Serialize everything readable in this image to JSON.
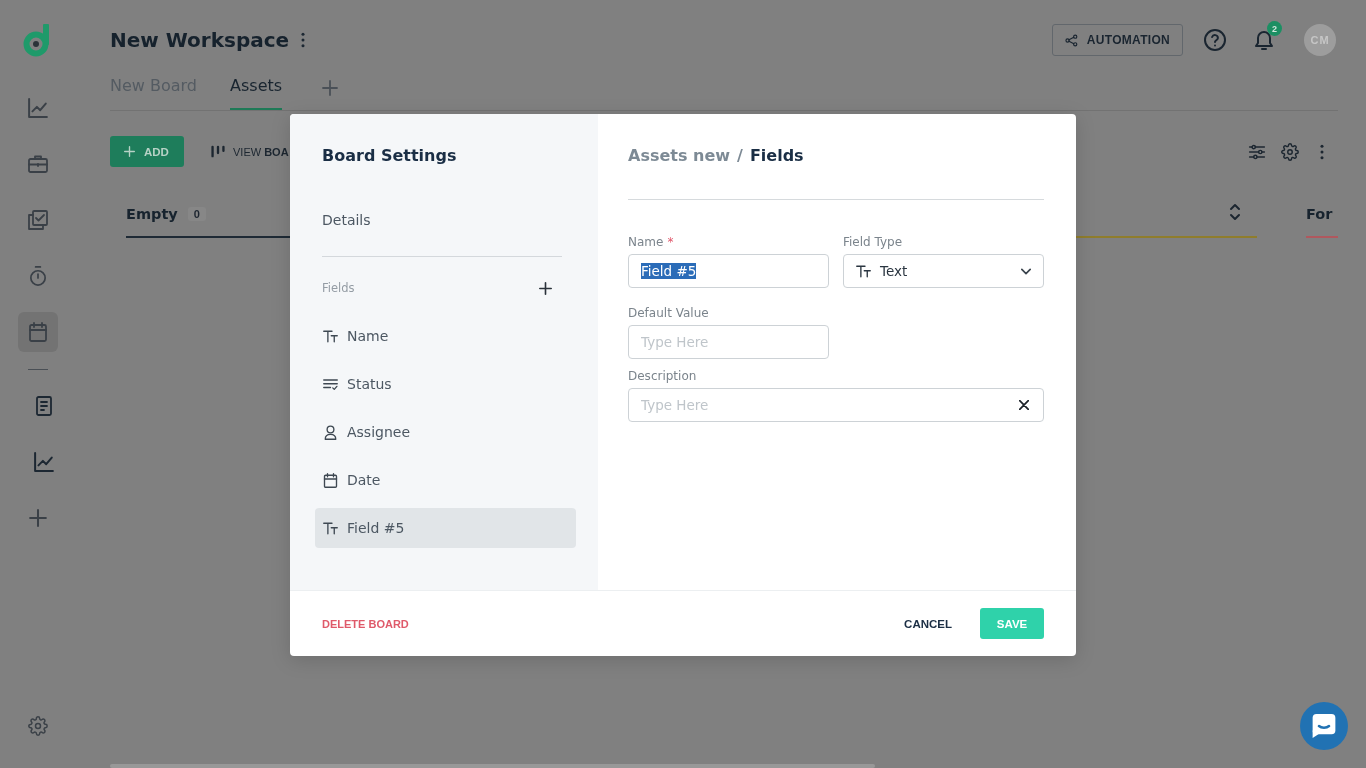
{
  "rail": {
    "items": [
      {
        "selected": false
      },
      {
        "selected": false
      },
      {
        "selected": false
      },
      {
        "selected": false
      },
      {
        "selected": true
      }
    ],
    "more_items": [
      {
        "selected": false
      },
      {
        "selected": false
      }
    ]
  },
  "header": {
    "title": "New Workspace",
    "automation_button": "AUTOMATION",
    "notification_count": "2",
    "avatar_initials": "CM"
  },
  "tabs": [
    {
      "label": "New Board",
      "selected": false
    },
    {
      "label": "Assets",
      "selected": true
    }
  ],
  "toolbar": {
    "add_button": "ADD",
    "view_button": "VIEW **BOA**"
  },
  "board": {
    "columns": [
      {
        "title": "Empty",
        "count": "0",
        "color": "#1e2a35"
      },
      {
        "color": "#8f7d2c"
      },
      {
        "title": "For",
        "color": "#b0585e"
      }
    ]
  },
  "modal": {
    "title": "Board Settings",
    "details": "Details",
    "fields_heading": "Fields",
    "fields": [
      {
        "label": "Name",
        "kind": "text",
        "selected": false
      },
      {
        "label": "Status",
        "kind": "status",
        "selected": false
      },
      {
        "label": "Assignee",
        "kind": "person",
        "selected": false
      },
      {
        "label": "Date",
        "kind": "date",
        "selected": false
      },
      {
        "label": "Field #5",
        "kind": "text",
        "selected": true
      }
    ],
    "breadcrumb": {
      "parent": "Assets new",
      "separator": "/",
      "current": "Fields"
    },
    "form": {
      "name": {
        "label": "Name",
        "required_mark": "*",
        "value": "Field #5",
        "highlighted": true
      },
      "field_type": {
        "label": "Field Type",
        "value": "Text",
        "kind": "text"
      },
      "default_value": {
        "label": "Default Value",
        "placeholder": "Type Here"
      },
      "description": {
        "label": "Description",
        "placeholder": "Type Here"
      }
    },
    "footer": {
      "delete": "DELETE BOARD",
      "cancel": "CANCEL",
      "save": "SAVE"
    }
  }
}
